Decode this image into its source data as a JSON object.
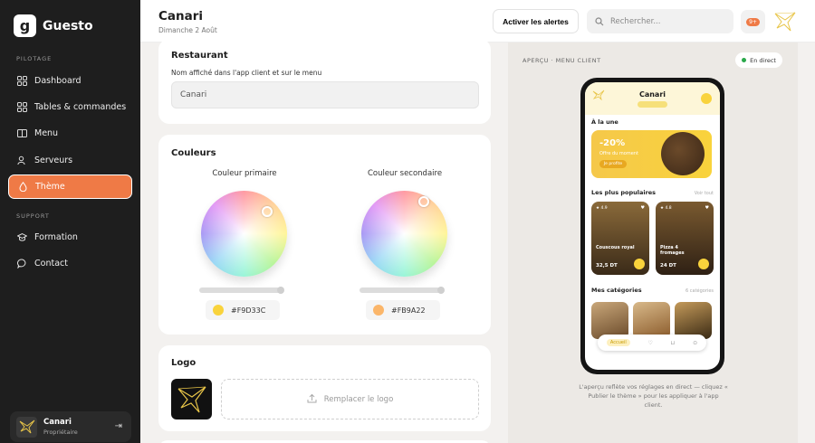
{
  "brand": {
    "name": "Guesto",
    "logo_letter": "g"
  },
  "sidebar": {
    "section_pilotage": "PILOTAGE",
    "section_support": "SUPPORT",
    "items": [
      {
        "label": "Dashboard",
        "icon": "grid-icon"
      },
      {
        "label": "Tables & commandes",
        "icon": "table-icon"
      },
      {
        "label": "Menu",
        "icon": "book-icon"
      },
      {
        "label": "Serveurs",
        "icon": "users-icon"
      },
      {
        "label": "Thème",
        "icon": "drop-icon",
        "active": true
      },
      {
        "label": "Formation",
        "icon": "graduation-icon"
      },
      {
        "label": "Contact",
        "icon": "chat-icon"
      }
    ],
    "user": {
      "name": "Canari",
      "role": "Propriétaire"
    }
  },
  "header": {
    "title": "Canari",
    "date": "Dimanche 2 Août",
    "alerts_button": "Activer les alertes",
    "search_placeholder": "Rechercher...",
    "notif_count": "9+"
  },
  "restaurant_card": {
    "title": "Restaurant",
    "field_label": "Nom affiché dans l'app client et sur le menu",
    "field_value": "Canari"
  },
  "colors_card": {
    "title": "Couleurs",
    "primary_label": "Couleur primaire",
    "primary_hex": "#F9D33C",
    "secondary_label": "Couleur secondaire",
    "secondary_hex": "#FB9A22"
  },
  "logo_card": {
    "title": "Logo",
    "replace_label": "Remplacer le logo"
  },
  "preview": {
    "label": "APERÇU · MENU CLIENT",
    "live_badge": "En direct",
    "phone": {
      "title": "Canari",
      "featured_section": "À la une",
      "promo_percent": "-20%",
      "promo_text": "Offre du moment",
      "promo_button": "Je profite",
      "popular_section": "Les plus populaires",
      "popular_link": "Voir tout",
      "dishes": [
        {
          "name": "Couscous royal",
          "price": "32,5 DT",
          "rating": "★ 4.9"
        },
        {
          "name": "Pizza 4 fromages",
          "price": "24 DT",
          "rating": "★ 4.8"
        }
      ],
      "categories_section": "Mes catégories",
      "categories_link": "6 catégories",
      "tab_home": "Accueil"
    },
    "note": "L'aperçu reflète vos réglages en direct — cliquez « Publier le thème » pour les appliquer à l'app client."
  }
}
